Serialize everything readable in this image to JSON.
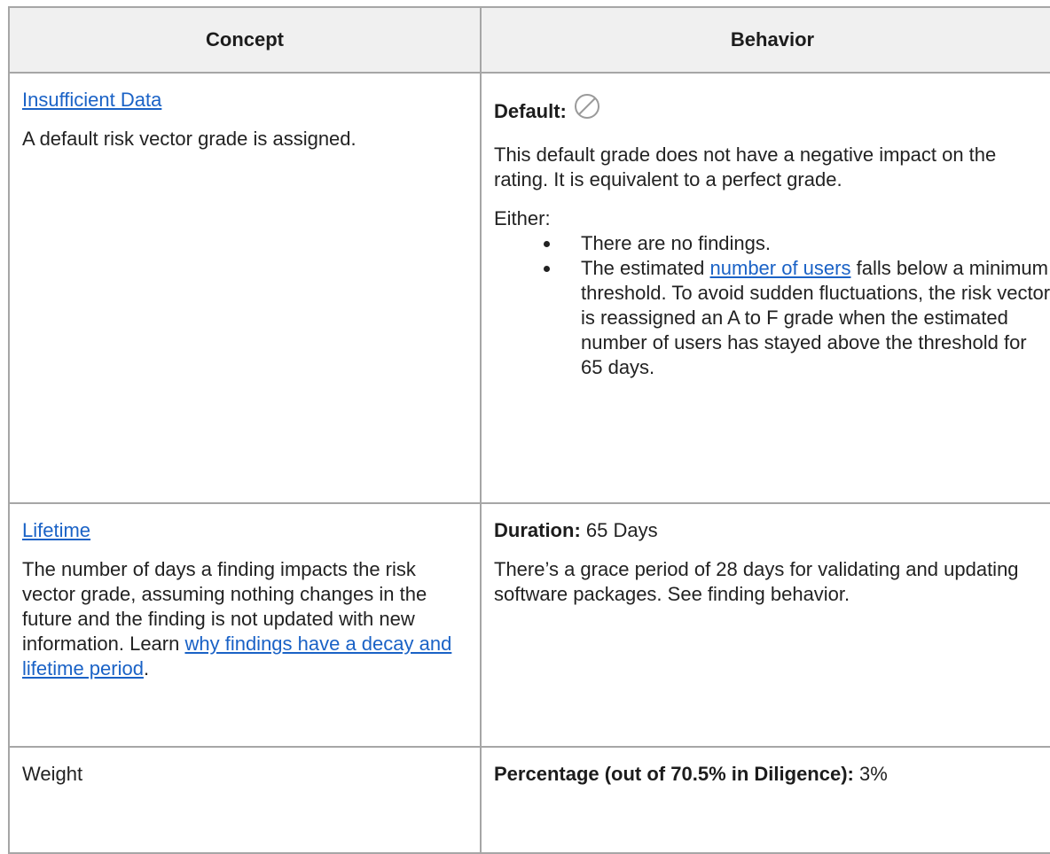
{
  "table": {
    "headers": {
      "concept": "Concept",
      "behavior": "Behavior"
    },
    "rows": [
      {
        "concept_link": "Insufficient Data",
        "concept_text": "A default risk vector grade is assigned.",
        "default_label": "Default:",
        "default_icon": "no-entry-circle-icon",
        "para1": "This default grade does not have a negative impact on the rating. It is equivalent to a perfect grade.",
        "either": "Either:",
        "bullet1": "There are no findings.",
        "bullet2_pre": "The estimated ",
        "bullet2_link": "number of users",
        "bullet2_post": " falls below a minimum threshold. To avoid sudden fluctuations, the risk vector is reassigned an A to F grade when the estimated number of users has stayed above the threshold for 65 days."
      },
      {
        "concept_link": "Lifetime",
        "concept_text": "The number of days a finding impacts the risk vector grade, assuming nothing changes in the future and the finding is not updated with new information.",
        "learn_pre": "Learn ",
        "learn_link": "why findings have a decay and lifetime period",
        "learn_post": ".",
        "duration_label": "Duration:",
        "duration_value": " 65 Days",
        "para": "There’s a grace period of 28 days for validating and updating software packages. See finding behavior."
      },
      {
        "concept_text": "Weight",
        "percentage_label": "Percentage (out of 70.5% in Diligence):",
        "percentage_value": " 3%"
      }
    ]
  },
  "colors": {
    "link": "#1a62c6",
    "header_bg": "#f0f0f0",
    "border": "#a6a6a6",
    "text": "#222222"
  }
}
